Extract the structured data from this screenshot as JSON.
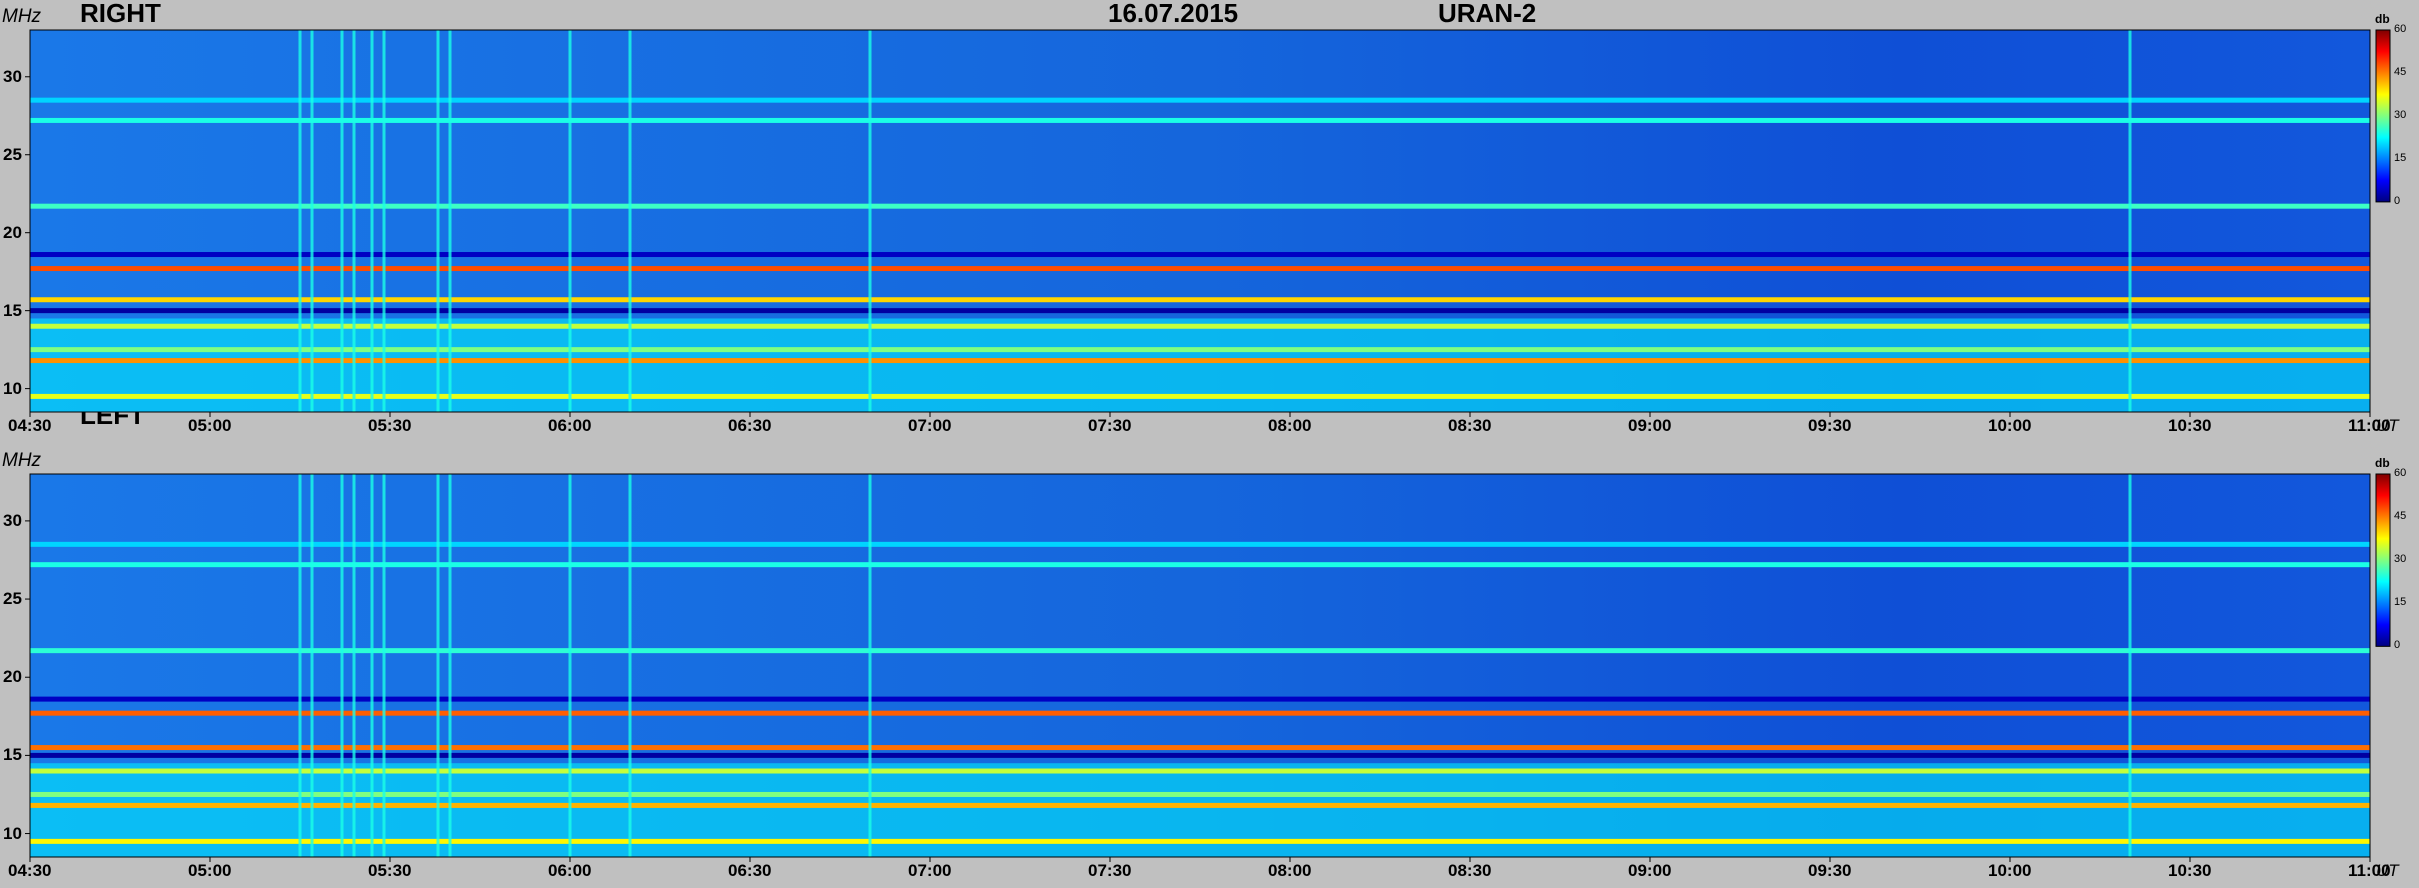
{
  "header": {
    "date": "16.07.2015",
    "instrument": "URAN-2"
  },
  "colors": {
    "background": "#c0c0c0",
    "colormap": [
      "#00007f",
      "#0000ff",
      "#0080ff",
      "#00ffff",
      "#80ff80",
      "#ffff00",
      "#ff8000",
      "#ff0000",
      "#7f0000"
    ]
  },
  "chart_data": [
    {
      "type": "heatmap",
      "title": "RIGHT",
      "ylabel": "MHz",
      "xlabel": "UT",
      "x_ticks": [
        "04:30",
        "05:00",
        "05:30",
        "06:00",
        "06:30",
        "07:00",
        "07:30",
        "08:00",
        "08:30",
        "09:00",
        "09:30",
        "10:00",
        "10:30",
        "11:00"
      ],
      "y_ticks": [
        10,
        15,
        20,
        25,
        30
      ],
      "xlim": [
        "04:30",
        "11:00"
      ],
      "ylim": [
        8.5,
        33
      ],
      "colorbar": {
        "label": "db",
        "ticks": [
          0,
          15,
          30,
          45,
          60
        ],
        "range": [
          0,
          60
        ]
      },
      "bands": [
        {
          "freq": 9.5,
          "level": 36
        },
        {
          "freq": 11.8,
          "level": 44
        },
        {
          "freq": 12.5,
          "level": 30
        },
        {
          "freq": 14.0,
          "level": 34
        },
        {
          "freq": 15.0,
          "level": 2
        },
        {
          "freq": 15.7,
          "level": 40
        },
        {
          "freq": 17.7,
          "level": 48
        },
        {
          "freq": 18.6,
          "level": 4
        },
        {
          "freq": 21.7,
          "level": 26
        },
        {
          "freq": 27.2,
          "level": 24
        },
        {
          "freq": 28.5,
          "level": 20
        }
      ],
      "bursts": [
        "05:15",
        "05:17",
        "05:22",
        "05:24",
        "05:27",
        "05:29",
        "05:38",
        "05:40",
        "06:00",
        "06:10",
        "06:50",
        "10:20"
      ]
    },
    {
      "type": "heatmap",
      "title": "LEFT",
      "ylabel": "MHz",
      "xlabel": "UT",
      "x_ticks": [
        "04:30",
        "05:00",
        "05:30",
        "06:00",
        "06:30",
        "07:00",
        "07:30",
        "08:00",
        "08:30",
        "09:00",
        "09:30",
        "10:00",
        "10:30",
        "11:00"
      ],
      "y_ticks": [
        10,
        15,
        20,
        25,
        30
      ],
      "xlim": [
        "04:30",
        "11:00"
      ],
      "ylim": [
        8.5,
        33
      ],
      "colorbar": {
        "label": "db",
        "ticks": [
          0,
          15,
          30,
          45,
          60
        ],
        "range": [
          0,
          60
        ]
      },
      "bands": [
        {
          "freq": 9.5,
          "level": 38
        },
        {
          "freq": 11.8,
          "level": 42
        },
        {
          "freq": 12.5,
          "level": 30
        },
        {
          "freq": 14.0,
          "level": 34
        },
        {
          "freq": 15.0,
          "level": 2
        },
        {
          "freq": 15.5,
          "level": 46
        },
        {
          "freq": 17.7,
          "level": 47
        },
        {
          "freq": 18.6,
          "level": 4
        },
        {
          "freq": 21.7,
          "level": 25
        },
        {
          "freq": 27.2,
          "level": 24
        },
        {
          "freq": 28.5,
          "level": 20
        }
      ],
      "bursts": [
        "05:15",
        "05:17",
        "05:22",
        "05:24",
        "05:27",
        "05:29",
        "05:38",
        "05:40",
        "06:00",
        "06:10",
        "06:50",
        "10:20"
      ]
    }
  ]
}
